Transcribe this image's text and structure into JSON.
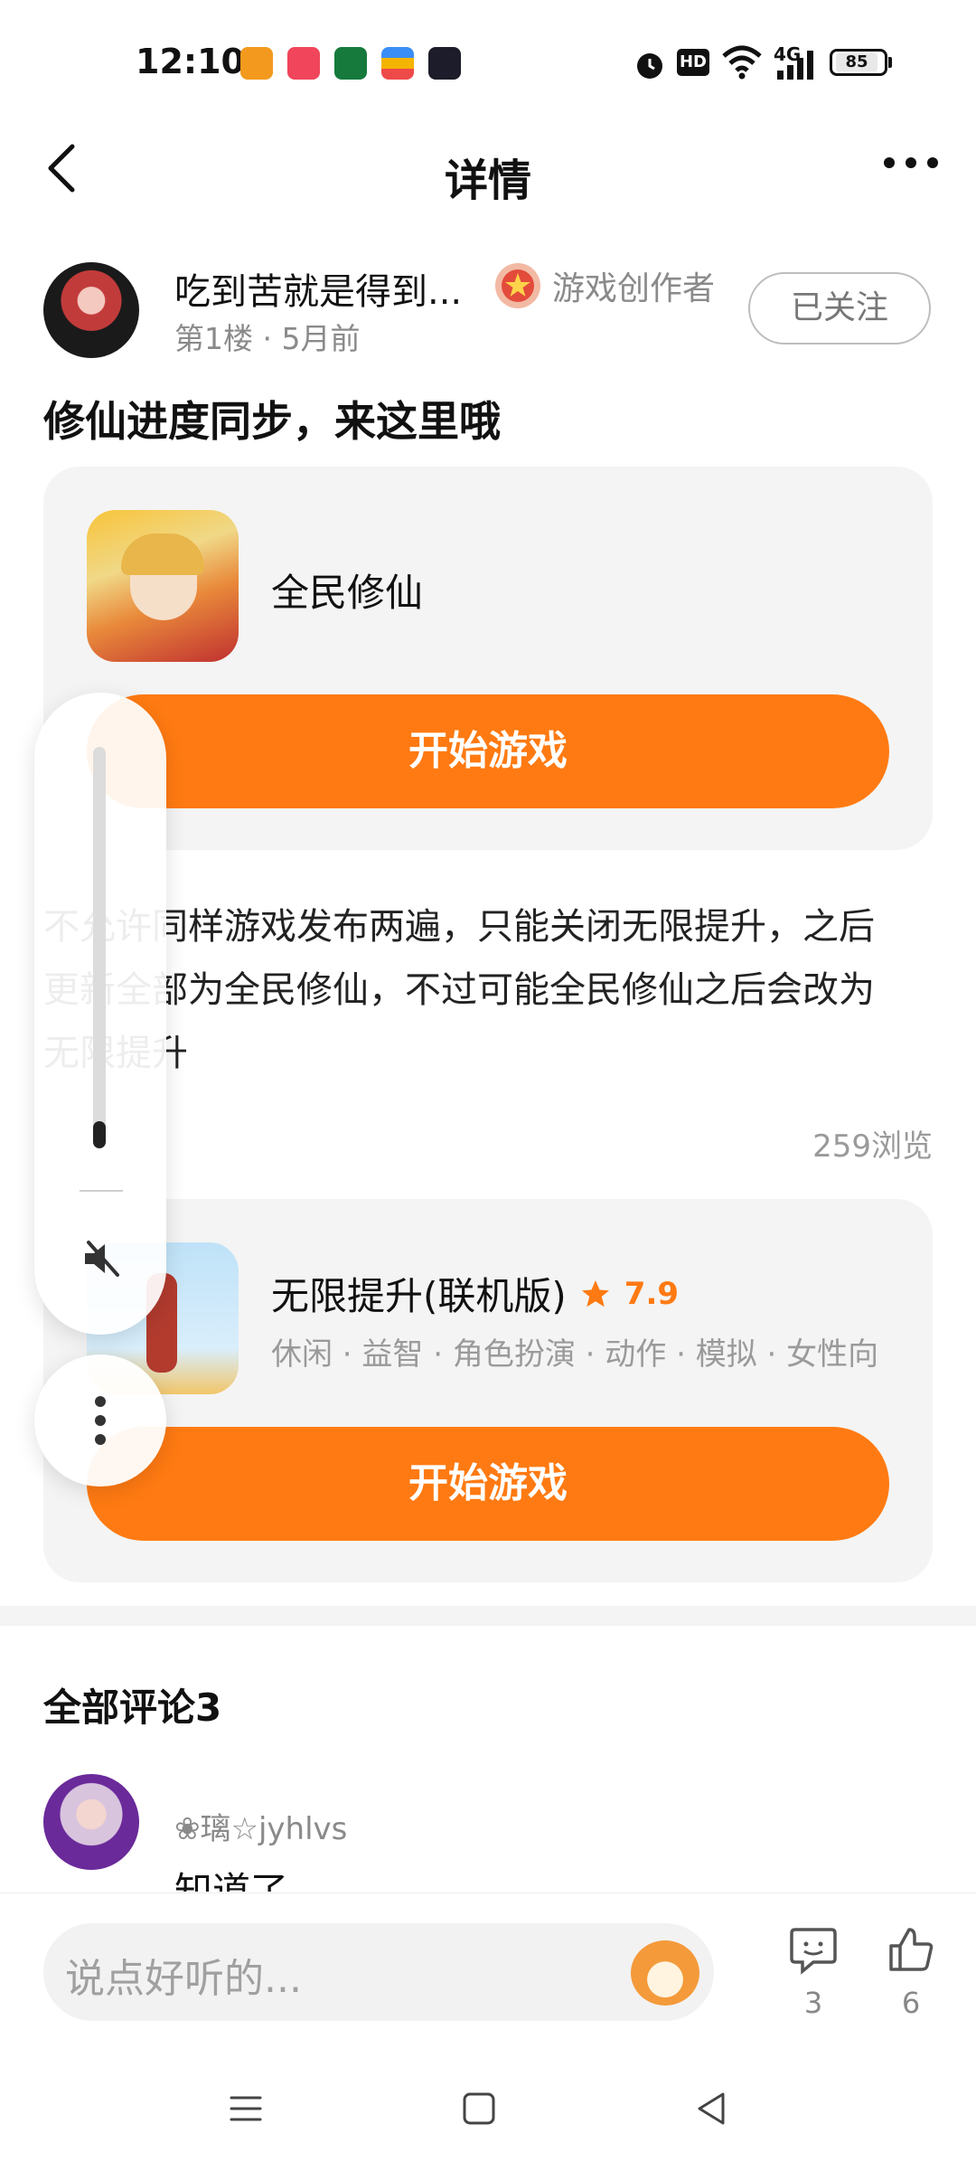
{
  "status_bar": {
    "time": "12:10",
    "battery": "85",
    "network": "4G",
    "hd_label": "HD"
  },
  "nav": {
    "title": "详情",
    "back_icon": "chevron-left-icon",
    "more_icon": "more-horizontal-icon"
  },
  "post": {
    "author_name": "吃到苦就是得到...",
    "author_meta": "第1楼 · 5月前",
    "creator_badge": "游戏创作者",
    "follow_label": "已关注",
    "title": "修仙进度同步，来这里哦",
    "body_lines": [
      "不允许同样游戏发布两遍，只能关闭无限提升，之后",
      "更新全部为全民修仙，不过可能全民修仙之后会改为",
      "无限提升"
    ],
    "views": "259浏览"
  },
  "game_cards": [
    {
      "name": "全民修仙",
      "play_label": "开始游戏"
    },
    {
      "name": "无限提升(联机版)",
      "rating": "7.9",
      "tags": "休闲 · 益智 · 角色扮演 · 动作 · 模拟 · 女性向",
      "play_label": "开始游戏"
    }
  ],
  "comments": {
    "title": "全部评论3",
    "first": {
      "name": "❀璃☆jyhlvs",
      "text": "知道了"
    }
  },
  "bottom_bar": {
    "input_placeholder": "说点好听的...",
    "comment_count": "3",
    "like_count": "6"
  },
  "colors": {
    "accent": "#ff7a12",
    "card_bg": "#f4f4f4"
  }
}
